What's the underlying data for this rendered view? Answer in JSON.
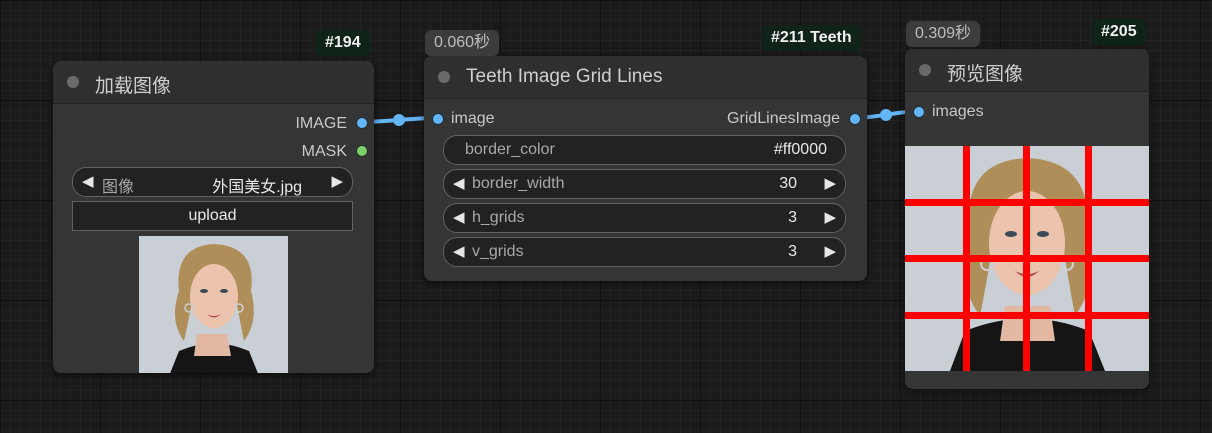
{
  "node_load": {
    "id_badge": "#194",
    "title": "加载图像",
    "outputs": [
      "IMAGE",
      "MASK"
    ],
    "image_widget": {
      "name": "图像",
      "value": "外国美女.jpg"
    },
    "upload_label": "upload"
  },
  "node_grid": {
    "time_badge": "0.060秒",
    "id_badge": "#211 Teeth",
    "title": "Teeth Image Grid Lines",
    "input": "image",
    "output": "GridLinesImage",
    "widgets": [
      {
        "name": "border_color",
        "value": "#ff0000"
      },
      {
        "name": "border_width",
        "value": "30"
      },
      {
        "name": "h_grids",
        "value": "3"
      },
      {
        "name": "v_grids",
        "value": "3"
      }
    ]
  },
  "node_preview": {
    "time_badge": "0.309秒",
    "id_badge": "#205",
    "title": "预览图像",
    "input": "images"
  },
  "colors": {
    "link": "#64b5f6",
    "mask_port": "#7ccf6a",
    "grid_line": "#ff0000"
  }
}
